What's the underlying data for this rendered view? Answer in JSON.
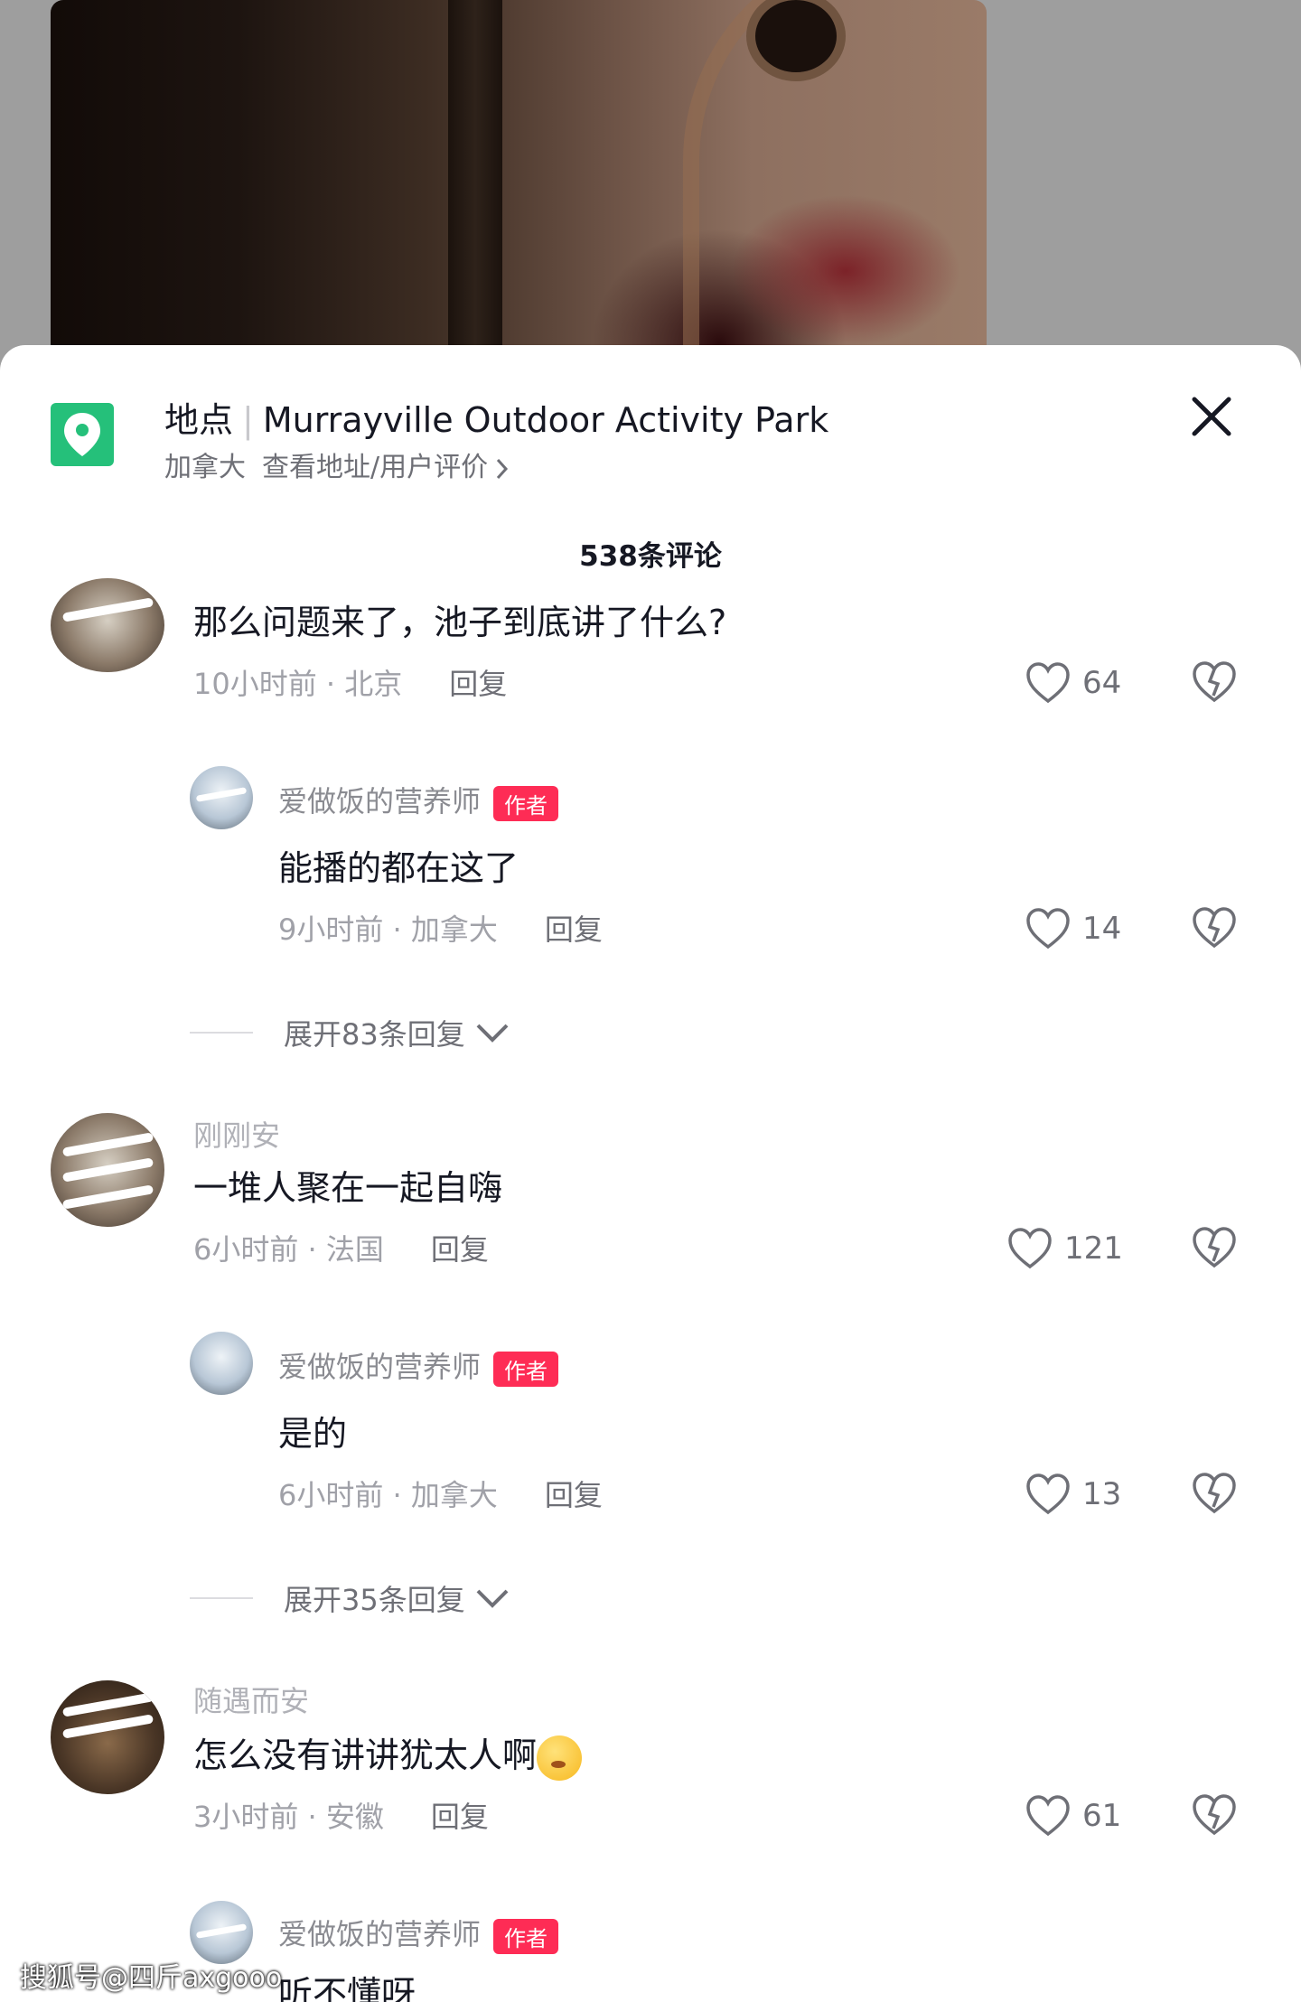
{
  "location": {
    "label": "地点",
    "name": "Murrayville Outdoor Activity Park",
    "country": "加拿大",
    "link": "查看地址/用户评价"
  },
  "comment_count": "538条评论",
  "comments": [
    {
      "text": "那么问题来了，池子到底讲了什么?",
      "meta": "10小时前 · 北京",
      "reply": "回复",
      "likes": "64",
      "replies": [
        {
          "user": "爱做饭的营养师",
          "badge": "作者",
          "text": "能播的都在这了",
          "meta": "9小时前 · 加拿大",
          "reply": "回复",
          "likes": "14"
        }
      ],
      "expand": "展开83条回复"
    },
    {
      "user": "刚刚安",
      "text": "一堆人聚在一起自嗨",
      "meta": "6小时前 · 法国",
      "reply": "回复",
      "likes": "121",
      "replies": [
        {
          "user": "爱做饭的营养师",
          "badge": "作者",
          "text": "是的",
          "meta": "6小时前 · 加拿大",
          "reply": "回复",
          "likes": "13"
        }
      ],
      "expand": "展开35条回复"
    },
    {
      "user": "随遇而安",
      "text": "怎么没有讲讲犹太人啊",
      "meta": "3小时前 · 安徽",
      "reply": "回复",
      "likes": "61",
      "replies": [
        {
          "user": "爱做饭的营养师",
          "badge": "作者",
          "text": "听不懂呀"
        }
      ]
    }
  ],
  "watermark": "搜狐号@四斤axgooo",
  "colors": {
    "accent": "#fe2c55",
    "location_icon": "#25c07a"
  }
}
